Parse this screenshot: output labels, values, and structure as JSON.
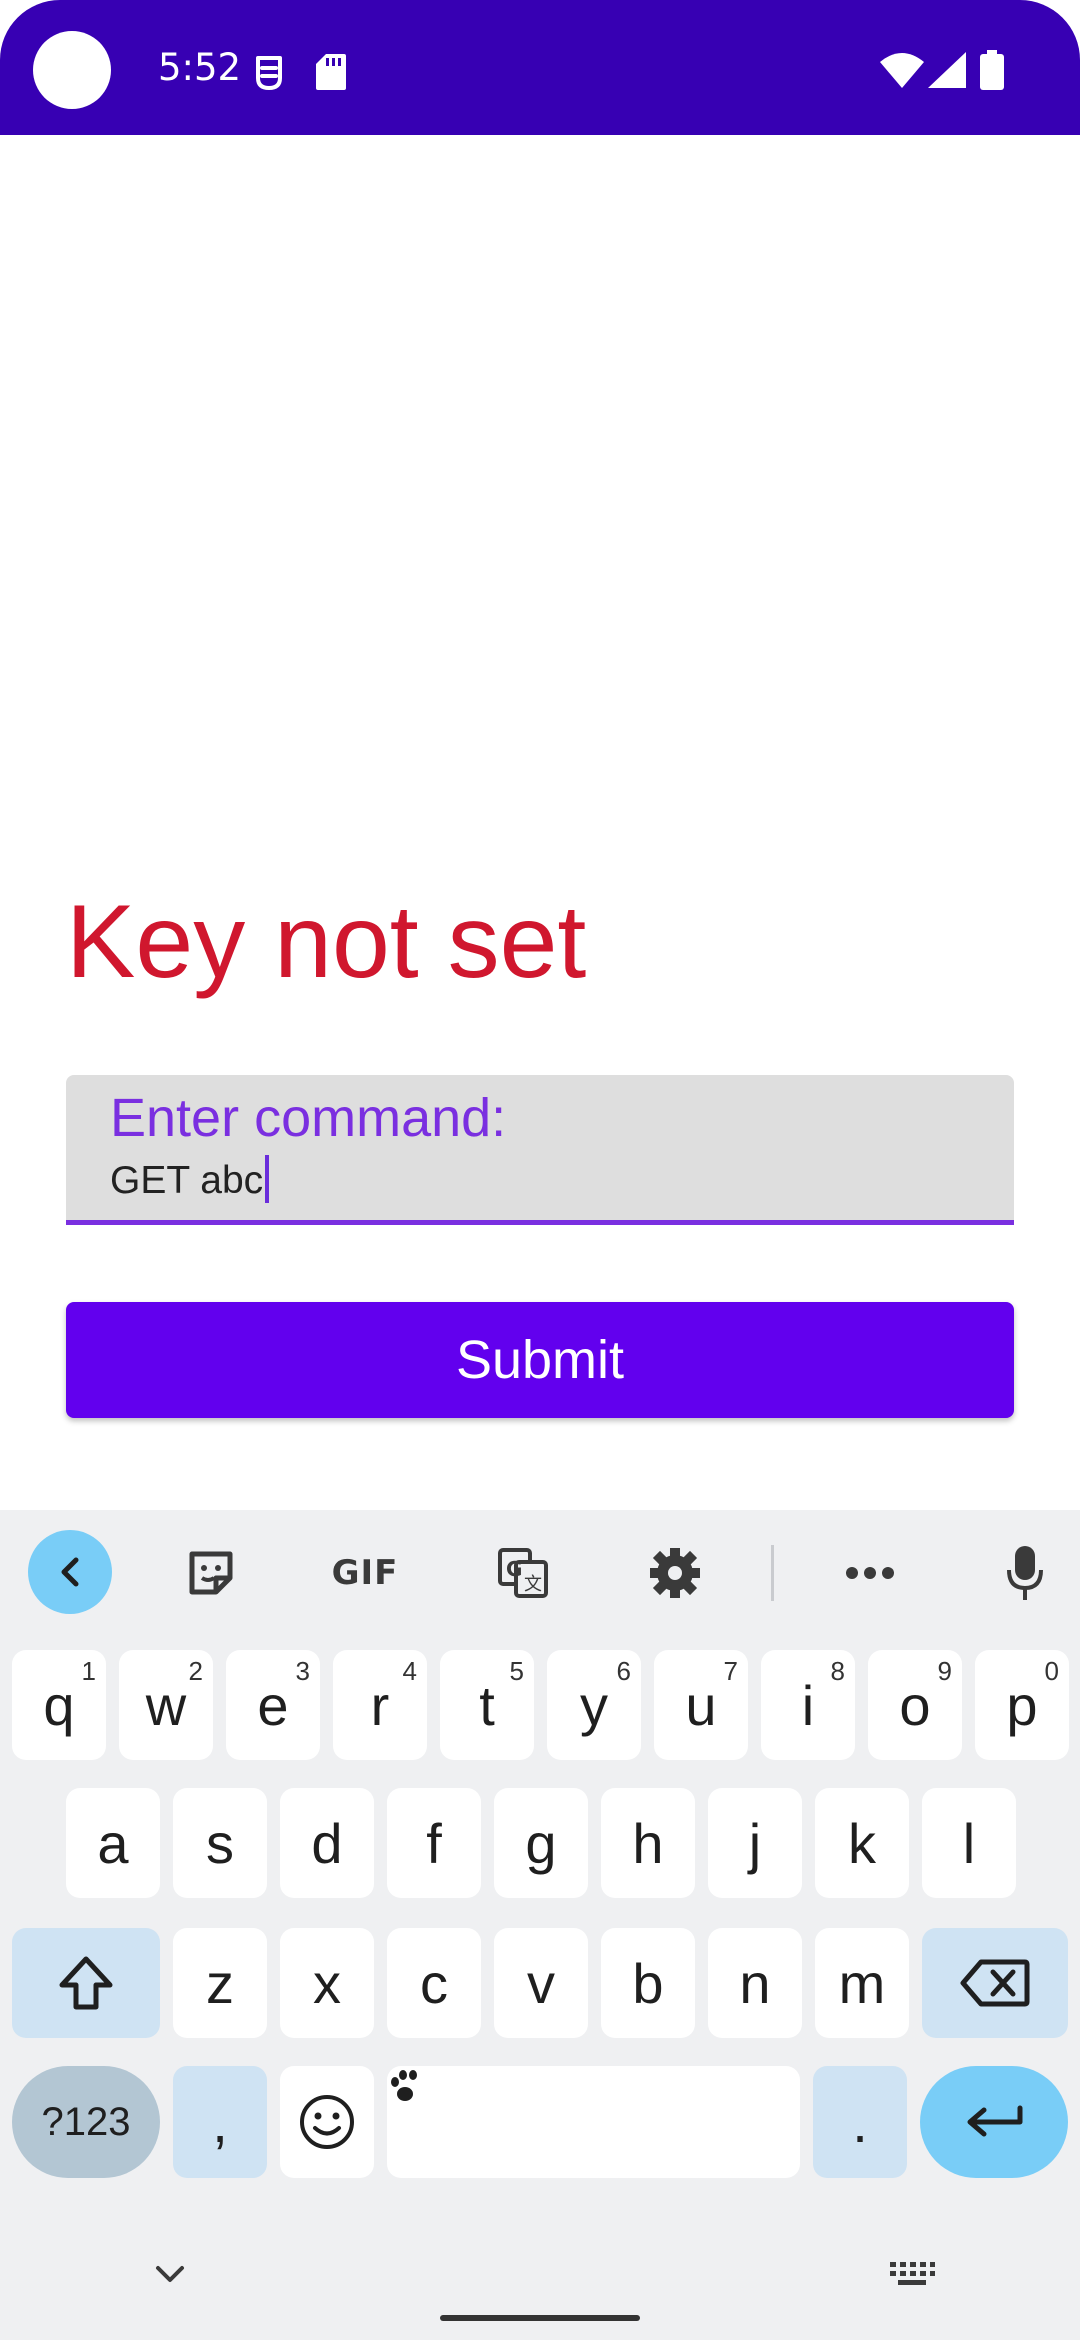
{
  "status_bar": {
    "time": "5:52",
    "icons": [
      "bug-icon",
      "sd-card-icon",
      "wifi-icon",
      "signal-icon",
      "battery-icon"
    ],
    "background": "#3700b3"
  },
  "app": {
    "key_status": "Key not set",
    "key_status_color": "#d0172e",
    "command_field": {
      "label": "Enter command:",
      "value": "GET abc"
    },
    "submit_label": "Submit",
    "accent": "#6200ee"
  },
  "keyboard": {
    "toolbar": {
      "icons": [
        "chevron-left-icon",
        "sticker-icon",
        "gif-icon",
        "translate-icon",
        "gear-icon",
        "more-icon",
        "microphone-icon"
      ],
      "gif_label": "GIF"
    },
    "row1": [
      {
        "key": "q",
        "hint": "1"
      },
      {
        "key": "w",
        "hint": "2"
      },
      {
        "key": "e",
        "hint": "3"
      },
      {
        "key": "r",
        "hint": "4"
      },
      {
        "key": "t",
        "hint": "5"
      },
      {
        "key": "y",
        "hint": "6"
      },
      {
        "key": "u",
        "hint": "7"
      },
      {
        "key": "i",
        "hint": "8"
      },
      {
        "key": "o",
        "hint": "9"
      },
      {
        "key": "p",
        "hint": "0"
      }
    ],
    "row2": [
      "a",
      "s",
      "d",
      "f",
      "g",
      "h",
      "j",
      "k",
      "l"
    ],
    "row3": [
      "z",
      "x",
      "c",
      "v",
      "b",
      "n",
      "m"
    ],
    "row4": {
      "sym": "?123",
      "comma": ",",
      "period": "."
    }
  }
}
